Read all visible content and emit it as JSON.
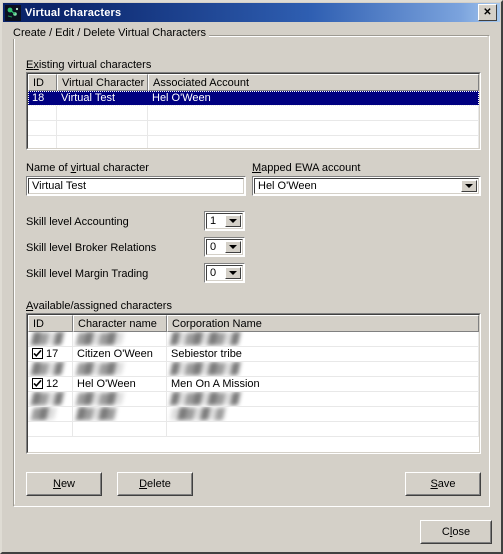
{
  "window": {
    "title": "Virtual characters",
    "icon": "app-icon",
    "close_label": "✕"
  },
  "groupbox": {
    "title": "Create / Edit / Delete Virtual Characters"
  },
  "existing": {
    "label_pre": "E",
    "label_accel": "x",
    "label_post": "isting virtual characters",
    "label_full": "Existing virtual characters",
    "columns": [
      "ID",
      "Virtual Character",
      "Associated Account"
    ],
    "rows": [
      {
        "id": "18",
        "character": "Virtual Test",
        "account": "Hel O'Ween",
        "selected": true
      },
      {
        "id": "",
        "character": "",
        "account": "",
        "selected": false
      },
      {
        "id": "",
        "character": "",
        "account": "",
        "selected": false
      },
      {
        "id": "",
        "character": "",
        "account": "",
        "selected": false
      }
    ]
  },
  "name_field": {
    "label_pre": "Name of ",
    "label_accel": "v",
    "label_post": "irtual character",
    "value": "Virtual Test"
  },
  "mapped_account": {
    "label_accel": "M",
    "label_post": "apped EWA account",
    "value": "Hel O'Ween"
  },
  "skills": [
    {
      "label": "Skill level Accounting",
      "value": "1"
    },
    {
      "label": "Skill level Broker Relations",
      "value": "0"
    },
    {
      "label": "Skill level Margin Trading",
      "value": "0"
    }
  ],
  "available": {
    "label_accel": "A",
    "label_post": "vailable/assigned characters",
    "label_full": "Available/assigned characters",
    "columns": [
      "ID",
      "Character name",
      "Corporation Name"
    ],
    "rows": [
      {
        "blurred": true,
        "checked": false,
        "id": "",
        "character": "",
        "corporation": ""
      },
      {
        "blurred": false,
        "checked": true,
        "id": "17",
        "character": "Citizen O'Ween",
        "corporation": "Sebiestor tribe"
      },
      {
        "blurred": true,
        "checked": false,
        "id": "",
        "character": "",
        "corporation": ""
      },
      {
        "blurred": false,
        "checked": true,
        "id": "12",
        "character": "Hel O'Ween",
        "corporation": "Men On A Mission"
      },
      {
        "blurred": true,
        "checked": false,
        "id": "",
        "character": "",
        "corporation": ""
      },
      {
        "blurred": true,
        "checked": false,
        "id": "",
        "character": "",
        "corporation": ""
      },
      {
        "blurred": false,
        "checked": false,
        "id": "",
        "character": "",
        "corporation": ""
      }
    ]
  },
  "buttons": {
    "new": {
      "accel": "N",
      "rest": "ew"
    },
    "delete": {
      "accel": "D",
      "rest": "elete"
    },
    "save": {
      "accel": "S",
      "rest": "ave"
    },
    "close": {
      "pre": "C",
      "accel": "l",
      "rest": "ose"
    }
  },
  "colors": {
    "face": "#d4d0c8",
    "title_start": "#0a246a",
    "title_end": "#a6c8ee",
    "selection": "#000080",
    "text": "#000000"
  }
}
